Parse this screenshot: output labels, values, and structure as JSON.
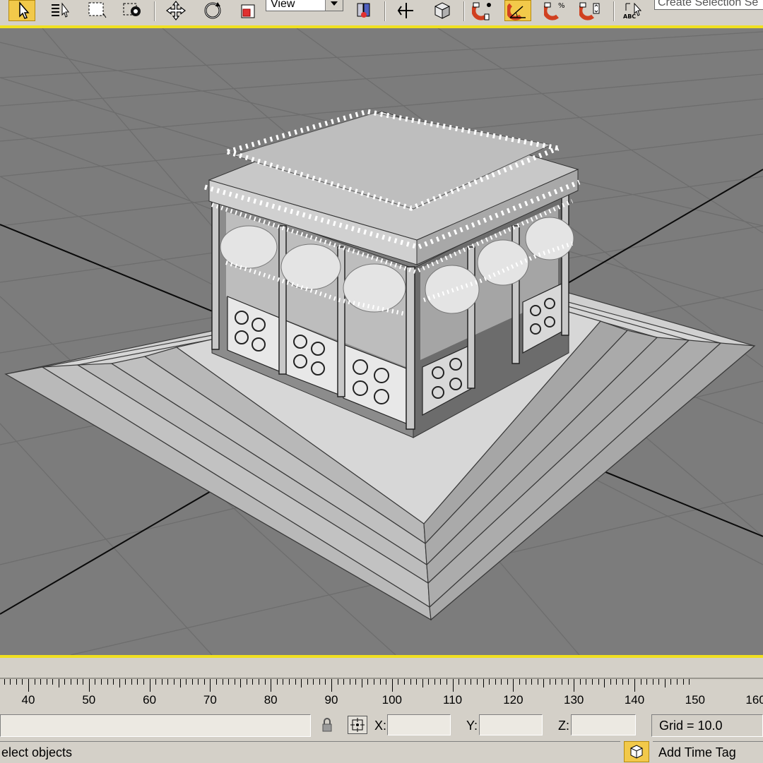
{
  "toolbar": {
    "view_dropdown": "View",
    "selection_set": "Create Selection Se",
    "buttons": [
      {
        "name": "select-object-icon",
        "active": true
      },
      {
        "name": "select-by-name-icon",
        "active": false
      },
      {
        "name": "rectangular-selection-icon",
        "active": false
      },
      {
        "name": "window-crossing-icon",
        "active": false
      },
      {
        "name": "move-icon",
        "active": false
      },
      {
        "name": "rotate-icon",
        "active": false
      },
      {
        "name": "scale-icon",
        "active": false
      },
      {
        "name": "use-pivot-center-icon",
        "active": false
      },
      {
        "name": "mirror-icon",
        "active": false
      },
      {
        "name": "align-icon",
        "active": false
      },
      {
        "name": "snap-toggle-icon",
        "active": false
      },
      {
        "name": "angle-snap-icon",
        "active": true
      },
      {
        "name": "percent-snap-icon",
        "active": false
      },
      {
        "name": "spinner-snap-icon",
        "active": false
      },
      {
        "name": "edit-named-selection-icon",
        "active": false
      }
    ],
    "accent_color": "#f2c94a"
  },
  "viewport": {
    "background_color": "#7c7c7c",
    "highlight_border_color": "#f0e020"
  },
  "time_ruler": {
    "labels": [
      "40",
      "50",
      "60",
      "70",
      "80",
      "90",
      "100",
      "110",
      "120",
      "130",
      "140",
      "150",
      "160"
    ]
  },
  "status": {
    "x_label": "X:",
    "y_label": "Y:",
    "z_label": "Z:",
    "x_value": "",
    "y_value": "",
    "z_value": "",
    "grid": "Grid = 10.0",
    "prompt": "elect objects",
    "time_tag": "Add Time Tag"
  }
}
